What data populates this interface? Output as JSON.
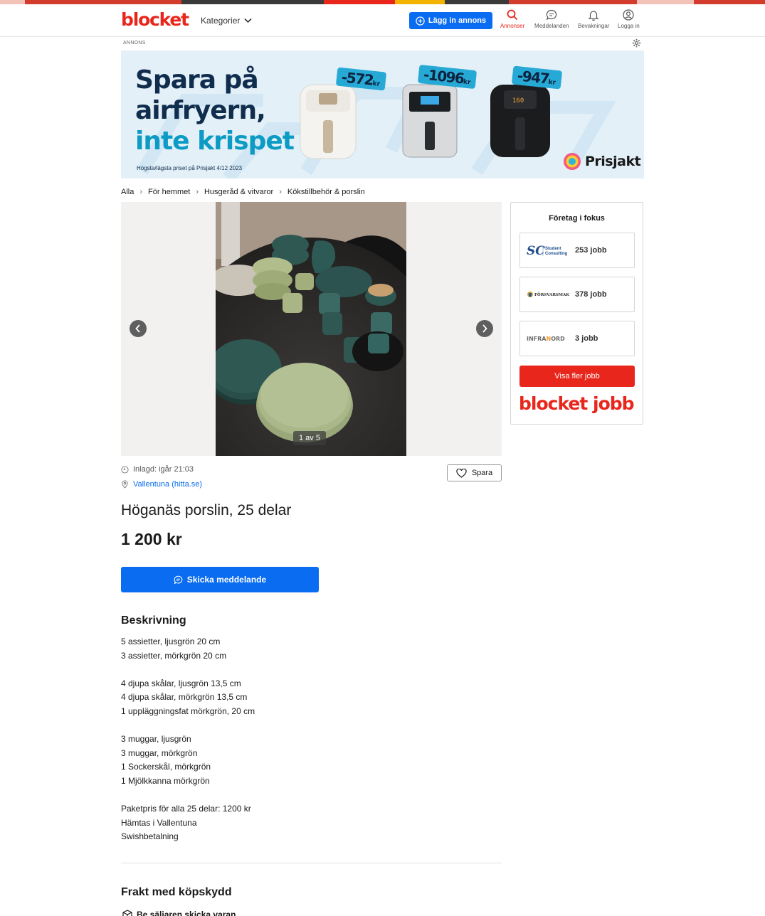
{
  "header": {
    "logo": "blocket",
    "categories_label": "Kategorier",
    "post_ad_label": "Lägg in annons",
    "nav": [
      {
        "label": "Annonser",
        "icon": "search-icon",
        "active": true
      },
      {
        "label": "Meddelanden",
        "icon": "chat-icon",
        "active": false
      },
      {
        "label": "Bevakningar",
        "icon": "bell-icon",
        "active": false
      },
      {
        "label": "Logga in",
        "icon": "user-icon",
        "active": false
      }
    ]
  },
  "ad": {
    "label": "ANNONS",
    "headline_line1": "Spara på",
    "headline_line2": "airfryern,",
    "headline_line3": "inte krispet",
    "footnote": "Högsta/lägsta priset på Prisjakt 4/12 2023",
    "price_tags": [
      "-572",
      "-1096",
      "-947"
    ],
    "price_tag_unit": "kr",
    "brand": "Prisjakt"
  },
  "breadcrumbs": [
    "Alla",
    "För hemmet",
    "Husgeråd & vitvaror",
    "Kökstillbehör & porslin"
  ],
  "gallery": {
    "counter": "1 av 5"
  },
  "sidebar": {
    "title": "Företag i fokus",
    "companies": [
      {
        "name": "Student Consulting",
        "jobs": "253 jobb"
      },
      {
        "name": "FÖRSVARSMAKTEN",
        "jobs": "378 jobb"
      },
      {
        "name": "INFRANORD",
        "jobs": "3 jobb"
      }
    ],
    "more_button": "Visa fler jobb",
    "brand_left": "blocket",
    "brand_right": "jobb"
  },
  "listing": {
    "posted": "Inlagd: igår 21:03",
    "location": "Vallentuna (hitta.se)",
    "save_label": "Spara",
    "title": "Höganäs porslin, 25 delar",
    "price": "1 200 kr",
    "message_button": "Skicka meddelande",
    "description_heading": "Beskrivning",
    "description_lines": [
      "5 assietter, ljusgrön 20 cm",
      "3 assietter, mörkgrön 20 cm",
      "",
      "4 djupa skålar, ljusgrön 13,5 cm",
      "4 djupa skålar, mörkgrön 13,5 cm",
      "1 uppläggningsfat mörkgrön, 20 cm",
      "",
      "3 muggar, ljusgrön",
      "3 muggar, mörkgrön",
      "1 Sockerskål, mörkgrön",
      "1 Mjölkkanna mörkgrön",
      "",
      "Paketpris för alla 25 delar: 1200 kr",
      "Hämtas i Vallentuna",
      "Swishbetalning"
    ],
    "shipping_heading": "Frakt med köpskydd",
    "shipping_sub": "Be säljaren skicka varan"
  },
  "colors": {
    "brand_red": "#e8261c",
    "action_blue": "#0a6cf0"
  }
}
